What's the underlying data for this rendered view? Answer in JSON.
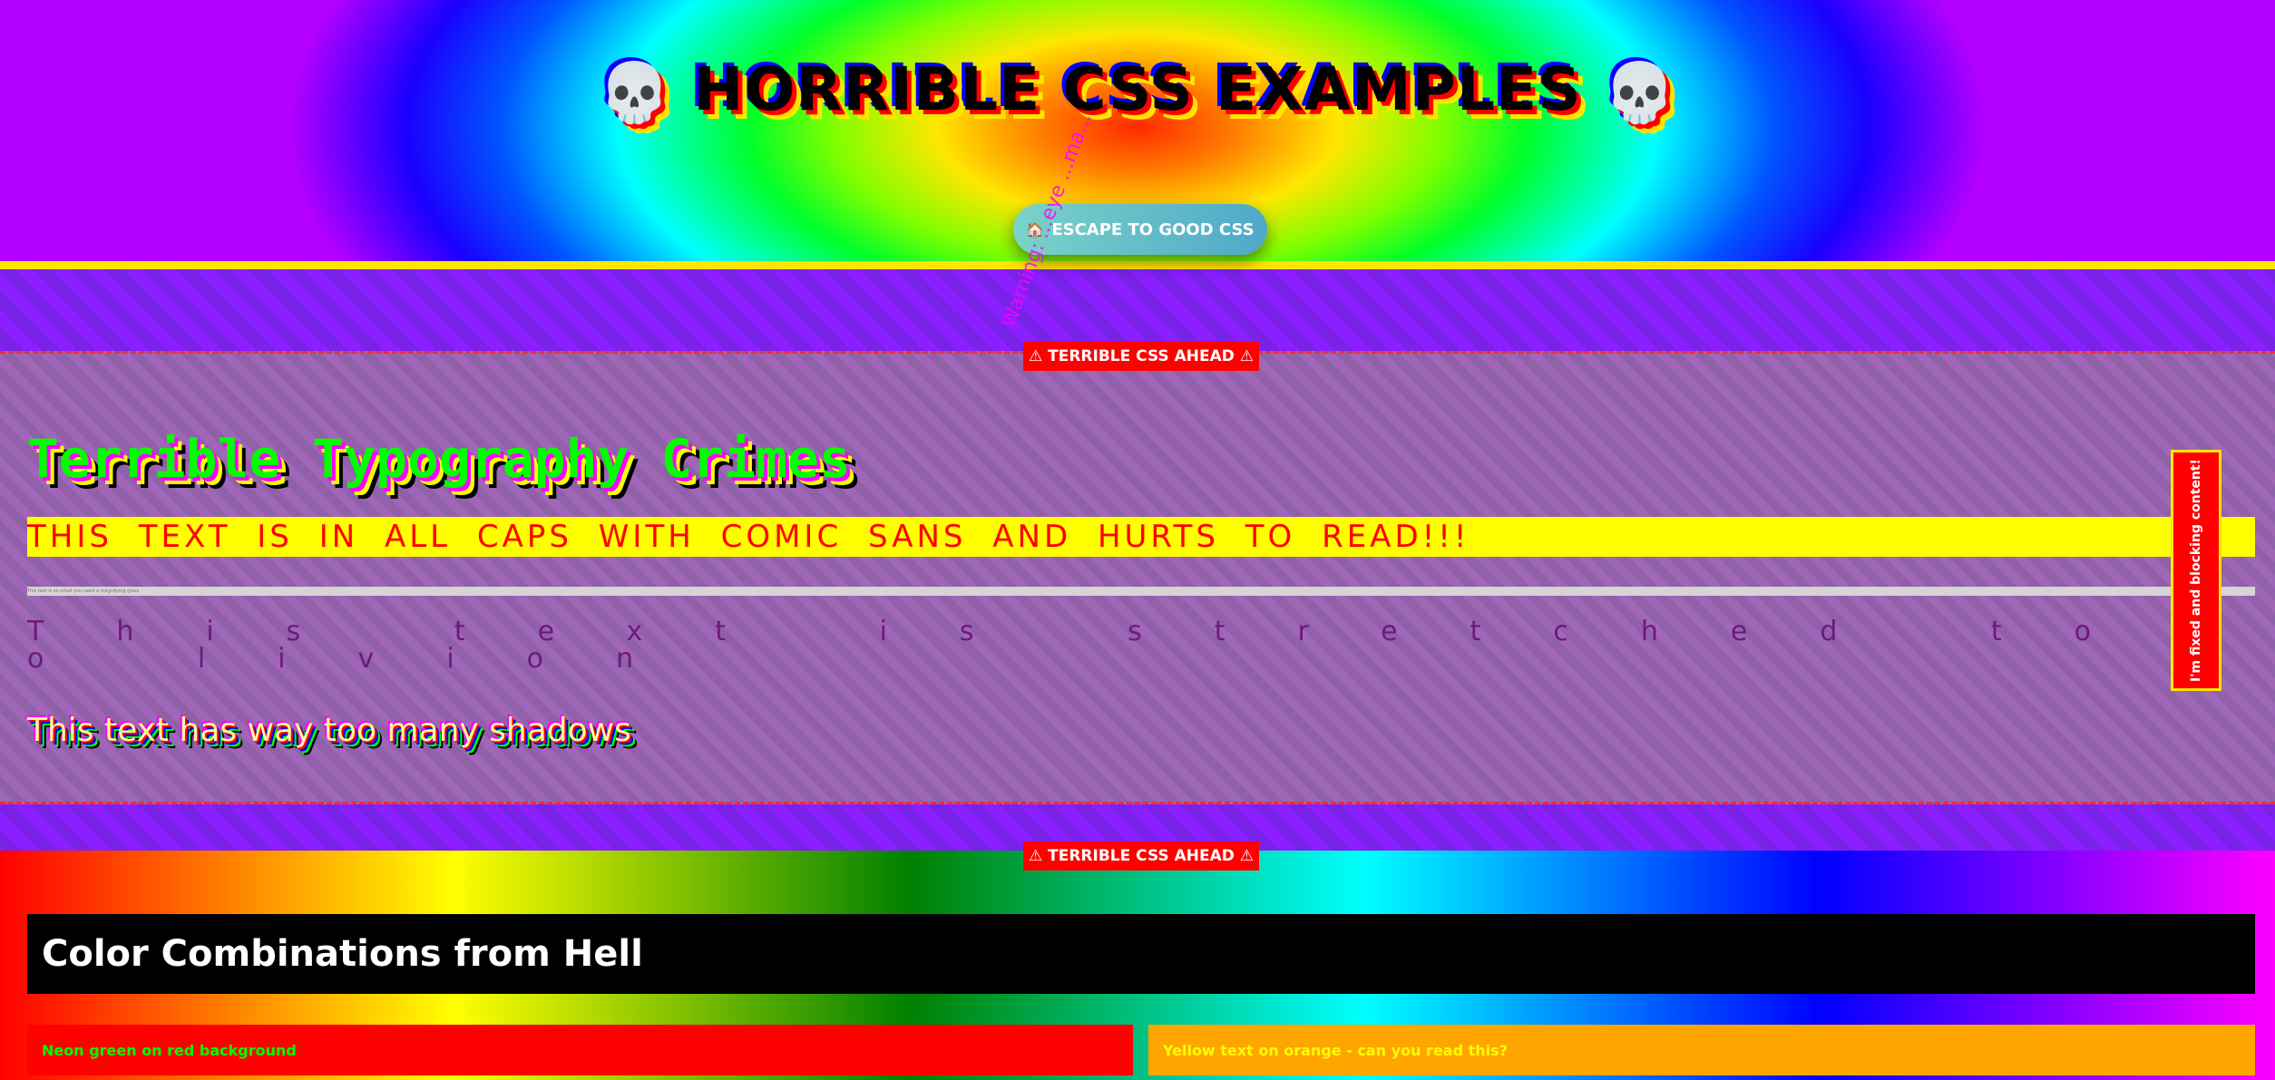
{
  "header": {
    "skull_left": "💀",
    "title": "HORRIBLE CSS EXAMPLES",
    "skull_right": "💀",
    "escape_button": {
      "icon": "🏠",
      "label": "ESCAPE TO GOOD CSS"
    }
  },
  "warnings": {
    "badge_label": "⚠ TERRIBLE CSS AHEAD ⚠",
    "rotated_text": "Warning: ...eye ...ma..."
  },
  "typography": {
    "title": "Terrible Typography Crimes",
    "caps_text": "THIS TEXT IS IN ALL CAPS WITH COMIC SANS AND HURTS TO READ!!!",
    "tiny_text": "This text is so small you need a magnifying glass",
    "stretched_text": "This text is stretched too livion",
    "shadow_text": "This text has way too many shadows"
  },
  "fixed_box": {
    "text": "I'm fixed and blocking content!"
  },
  "colors": {
    "heading": "Color Combinations from Hell",
    "combo_green": "Neon green on red background",
    "combo_yellow": "Yellow text on orange - can you read this?"
  }
}
